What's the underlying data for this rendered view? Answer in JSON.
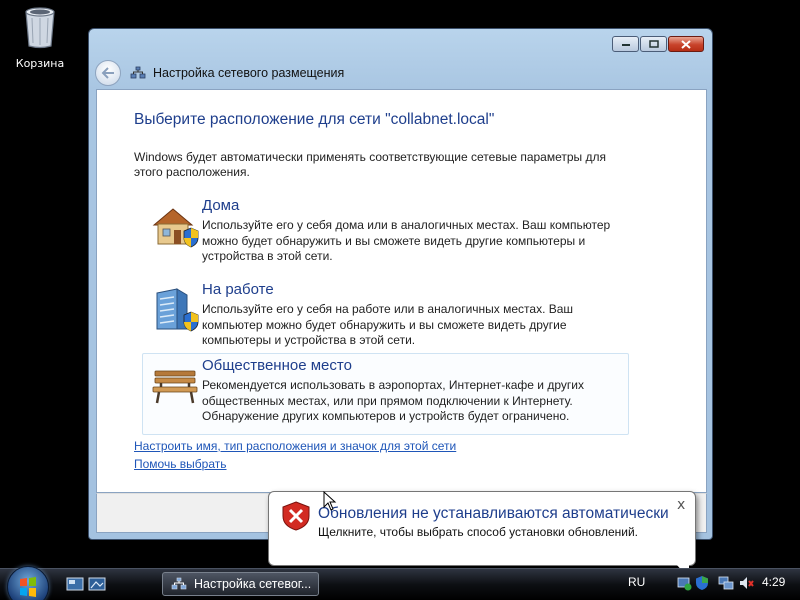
{
  "desktop": {
    "recycle_bin_label": "Корзина"
  },
  "window": {
    "title": "Настройка сетевого размещения",
    "heading": "Выберите расположение для сети \"collabnet.local\"",
    "intro": "Windows будет автоматически применять соответствующие сетевые параметры для этого расположения.",
    "options": [
      {
        "title": "Дома",
        "description": "Используйте его у себя дома или в аналогичных местах. Ваш компьютер можно будет обнаружить и вы сможете видеть другие компьютеры и устройства в этой сети.",
        "icon": "home-icon"
      },
      {
        "title": "На работе",
        "description": "Используйте его у себя на работе или в аналогичных местах. Ваш компьютер можно будет обнаружить и вы сможете видеть другие компьютеры и устройства в этой сети.",
        "icon": "work-building-icon"
      },
      {
        "title": "Общественное место",
        "description": "Рекомендуется использовать в аэропортах, Интернет-кафе и других общественных местах, или при прямом подключении к Интернету. Обнаружение других компьютеров и устройств будет ограничено.",
        "icon": "park-bench-icon"
      }
    ],
    "links": {
      "customize": "Настроить имя, тип расположения и значок для этой сети",
      "help": "Помочь выбрать"
    }
  },
  "notification": {
    "title": "Обновления не устанавливаются автоматически",
    "text": "Щелкните, чтобы выбрать способ установки обновлений.",
    "close": "x"
  },
  "taskbar": {
    "task_label": "Настройка сетевог...",
    "language": "RU",
    "clock": "4:29"
  },
  "colors": {
    "accent_text": "#1e3e8c",
    "link": "#1f56b8",
    "taskbar": "#000000"
  }
}
